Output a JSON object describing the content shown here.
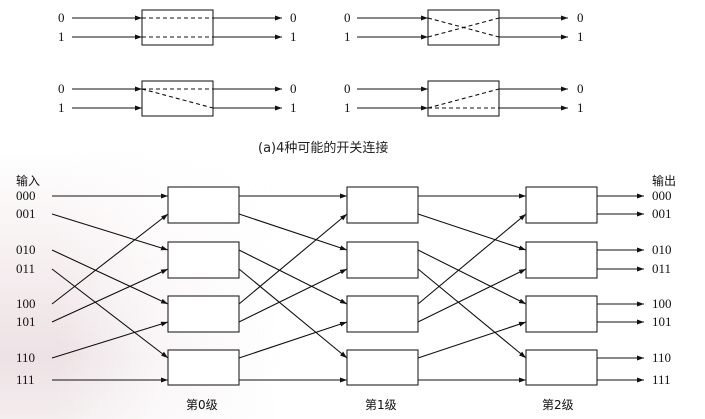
{
  "top_panel": {
    "caption": "(a)4种可能的开关连接",
    "port_labels": [
      "0",
      "1"
    ],
    "connection_types": [
      "straight",
      "exchange",
      "upper-broadcast",
      "lower-broadcast"
    ]
  },
  "network": {
    "input_heading": "输入",
    "output_heading": "输出",
    "input_labels": [
      "000",
      "001",
      "010",
      "011",
      "100",
      "101",
      "110",
      "111"
    ],
    "output_labels": [
      "000",
      "001",
      "010",
      "011",
      "100",
      "101",
      "110",
      "111"
    ],
    "stage_labels": [
      "第0级",
      "第1级",
      "第2级"
    ],
    "switches_per_stage": 4
  },
  "colors": {
    "line": "#111111",
    "box_fill": "#ffffff"
  }
}
